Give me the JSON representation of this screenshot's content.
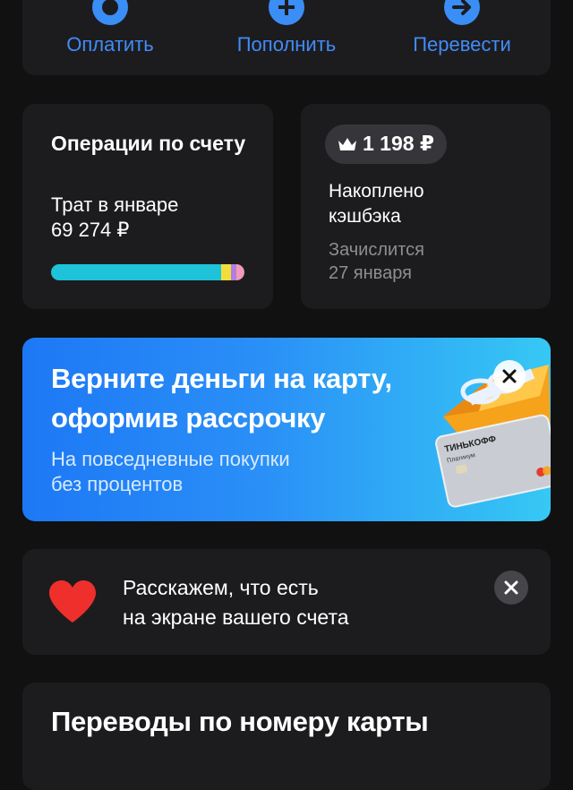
{
  "actions": [
    {
      "label": "Оплатить",
      "icon": "pay-icon"
    },
    {
      "label": "Пополнить",
      "icon": "plus-icon"
    },
    {
      "label": "Перевести",
      "icon": "arrow-right-icon"
    }
  ],
  "operations": {
    "title": "Операции по счету",
    "spent_label": "Трат в январе",
    "spent_amount": "69 274 ₽",
    "bar": [
      {
        "share": 0.88,
        "color": "#1ec3da"
      },
      {
        "share": 0.05,
        "color": "#f2de3b"
      },
      {
        "share": 0.03,
        "color": "#b07ee0"
      },
      {
        "share": 0.04,
        "color": "#f19abd"
      }
    ]
  },
  "cashback": {
    "amount": "1 198 ₽",
    "label_line1": "Накоплено",
    "label_line2": "кэшбэка",
    "note_line1": "Зачислится",
    "note_line2": "27 января"
  },
  "promo": {
    "title_line1": "Верните деньги на карту,",
    "title_line2": "оформив рассрочку",
    "subtitle_line1": "На повседневные покупки",
    "subtitle_line2": "без процентов",
    "card_brand": "ТИНЬКОФФ",
    "card_tier": "Платинум"
  },
  "info": {
    "line1": "Расскажем, что есть",
    "line2": "на экране вашего счета"
  },
  "transfers": {
    "title": "Переводы по номеру карты"
  },
  "colors": {
    "accent": "#428bf9",
    "background": "#111112",
    "card": "#1c1c1e"
  }
}
